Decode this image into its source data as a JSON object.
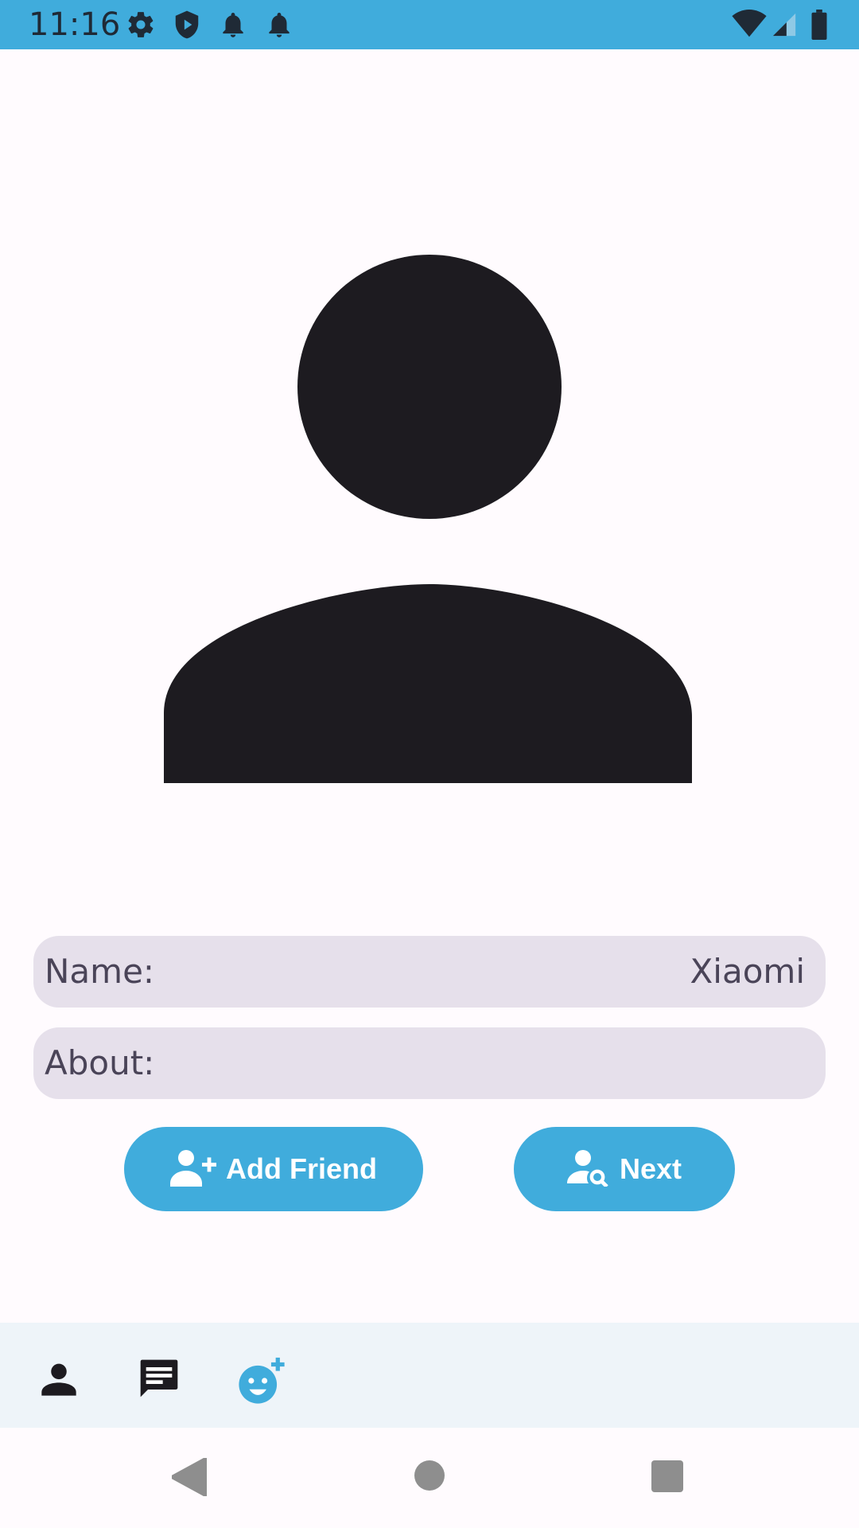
{
  "status_bar": {
    "time": "11:16",
    "icons": [
      "settings-icon",
      "shield-play-icon",
      "bell-icon",
      "bell-icon",
      "wifi-icon",
      "signal-icon",
      "battery-icon"
    ],
    "background": "#40acdc"
  },
  "profile": {
    "avatar_icon": "person-icon",
    "name_label": "Name:",
    "name_value": "Xiaomi",
    "about_label": "About:"
  },
  "actions": {
    "add_friend_label": "Add Friend",
    "add_friend_icon": "person-add-icon",
    "next_label": "Next",
    "next_icon": "person-search-icon",
    "button_color": "#40acdc"
  },
  "bottom_nav": {
    "items": [
      "person-icon",
      "chat-icon",
      "face-add-icon"
    ]
  },
  "system_nav": {
    "items": [
      "back-icon",
      "home-icon",
      "recents-icon"
    ]
  }
}
